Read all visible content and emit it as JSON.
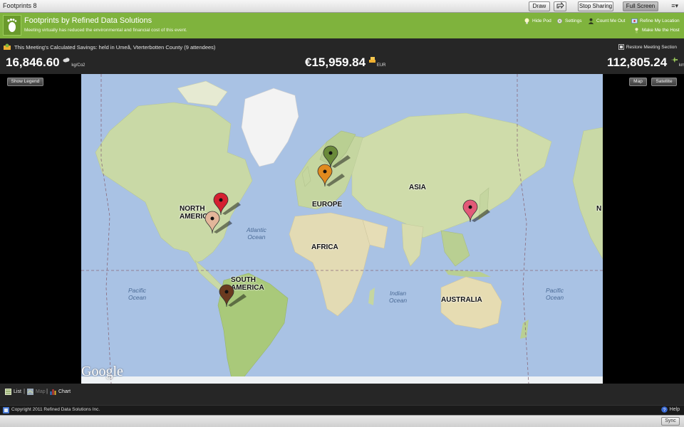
{
  "window": {
    "title": "Footprints 8"
  },
  "toolbar": {
    "draw_label": "Draw",
    "stop_sharing_label": "Stop Sharing",
    "full_screen_label": "Full Screen",
    "menu_glyph": "≡▾"
  },
  "header": {
    "title": "Footprints by Refined Data Solutions",
    "subtitle": "Meeting virtually has reduced the environmental and financial cost of this event.",
    "links": {
      "hide_pod": "Hide Pod",
      "settings": "Settings",
      "count_me_out": "Count Me Out",
      "refine_location": "Refine My Location",
      "make_host": "Make Me the Host"
    }
  },
  "savings": {
    "label": "This Meeting's Calculated Savings: held in Umeå, Vterterbotten County (9 attendees)",
    "restore_label": "Restore Meeting Section",
    "co2_value": "16,846.60",
    "co2_unit": "kg/Co2",
    "cost_value": "€15,959.84",
    "cost_unit": "EUR",
    "distance_value": "112,805.24",
    "distance_unit": "km"
  },
  "map": {
    "show_legend_label": "Show Legend",
    "map_label": "Map",
    "satellite_label": "Satellite",
    "google_logo": "Google",
    "regions": {
      "north_america_1": "NORTH",
      "north_america_2": "AMERICA",
      "europe": "EUROPE",
      "asia": "ASIA",
      "africa": "AFRICA",
      "south_america_1": "SOUTH",
      "south_america_2": "AMERICA",
      "australia": "AUSTRALIA",
      "na_repeat": "N"
    },
    "oceans": {
      "atlantic_1": "Atlantic",
      "atlantic_2": "Ocean",
      "pacific_left_1": "Pacific",
      "pacific_left_2": "Ocean",
      "indian_1": "Indian",
      "indian_2": "Ocean",
      "pacific_right_1": "Pacific",
      "pacific_right_2": "Ocean"
    },
    "pin_colors": {
      "sweden_north": "#6a8a3a",
      "sweden_south": "#e08a1e",
      "usa_northeast": "#d42030",
      "usa_south": "#e3b69a",
      "japan": "#e25a78",
      "south_america": "#6b3a1f"
    }
  },
  "views": {
    "list_label": "List",
    "map_label": "Map",
    "chart_label": "Chart",
    "separator": "|"
  },
  "footer": {
    "copyright": "Copyright 2011 Refined Data Solutions Inc.",
    "help_label": "Help"
  },
  "statusbar": {
    "sync_label": "Sync"
  }
}
